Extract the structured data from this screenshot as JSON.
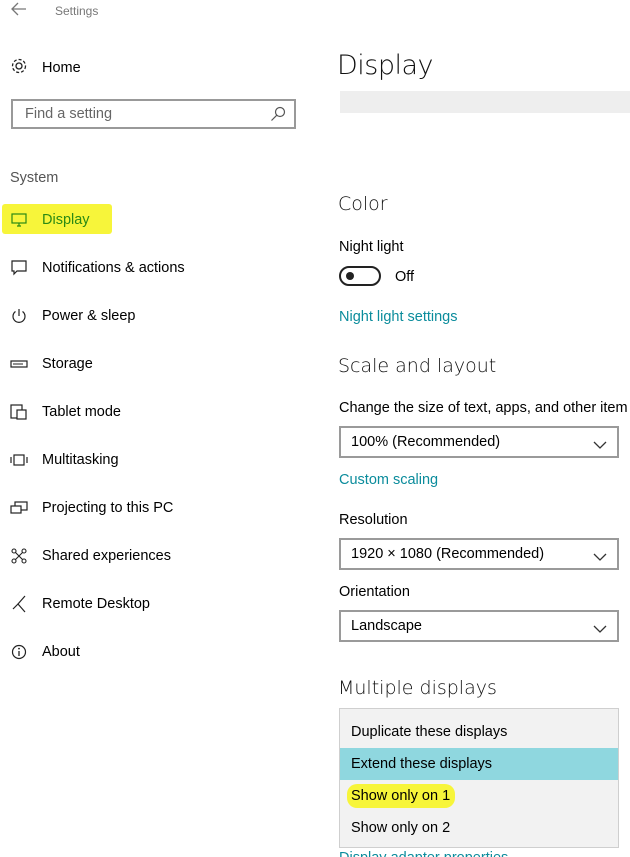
{
  "window": {
    "title": "Settings"
  },
  "sidebar": {
    "home_label": "Home",
    "search_placeholder": "Find a setting",
    "section_label": "System",
    "items": [
      {
        "label": "Display",
        "icon": "monitor-icon",
        "active": true
      },
      {
        "label": "Notifications & actions",
        "icon": "message-icon"
      },
      {
        "label": "Power & sleep",
        "icon": "power-icon"
      },
      {
        "label": "Storage",
        "icon": "storage-icon"
      },
      {
        "label": "Tablet mode",
        "icon": "tablet-icon"
      },
      {
        "label": "Multitasking",
        "icon": "multitasking-icon"
      },
      {
        "label": "Projecting to this PC",
        "icon": "projecting-icon"
      },
      {
        "label": "Shared experiences",
        "icon": "shared-icon"
      },
      {
        "label": "Remote Desktop",
        "icon": "remote-desktop-icon"
      },
      {
        "label": "About",
        "icon": "info-icon"
      }
    ]
  },
  "main": {
    "title": "Display",
    "color": {
      "heading": "Color",
      "night_light_label": "Night light",
      "toggle_state": "Off",
      "night_light_settings_link": "Night light settings"
    },
    "scale": {
      "heading": "Scale and layout",
      "size_label": "Change the size of text, apps, and other item",
      "size_value": "100% (Recommended)",
      "custom_scaling_link": "Custom scaling",
      "resolution_label": "Resolution",
      "resolution_value": "1920 × 1080 (Recommended)",
      "orientation_label": "Orientation",
      "orientation_value": "Landscape"
    },
    "multiple_displays": {
      "heading": "Multiple displays",
      "options": [
        "Duplicate these displays",
        "Extend these displays",
        "Show only on 1",
        "Show only on 2"
      ],
      "selected_option": "Extend these displays",
      "highlighted_option": "Show only on 1",
      "adapter_link": "Display adapter properties"
    }
  },
  "colors": {
    "accent": "#0b8c9c",
    "selected_option_bg": "#8fd7df",
    "highlighter": "#f7f53a",
    "active_nav_text": "#2a8a14"
  }
}
